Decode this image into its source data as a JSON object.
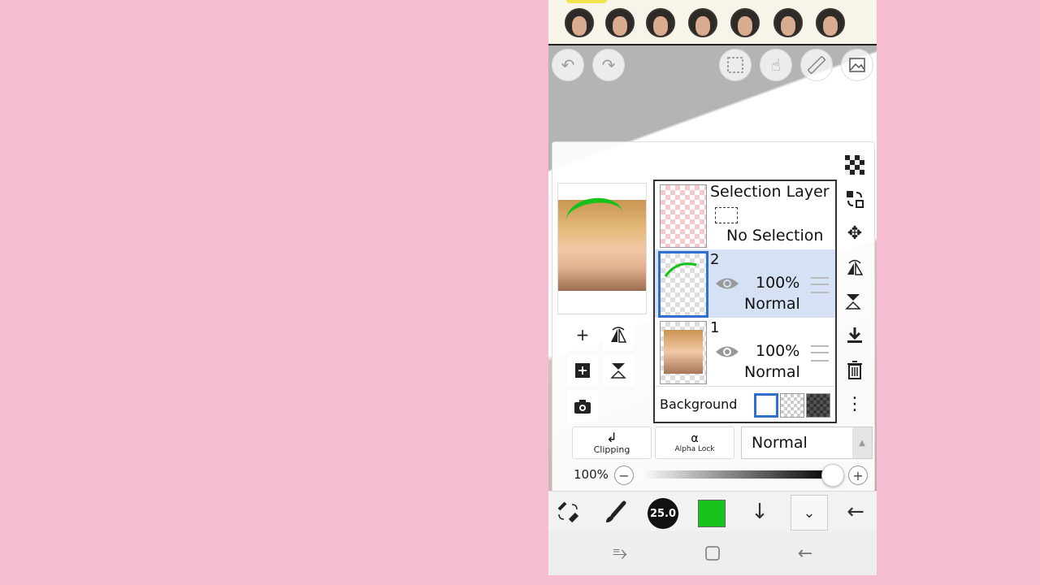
{
  "toolbar": {
    "undo_icon": "undo-icon",
    "redo_icon": "redo-icon",
    "selection_icon": "dashed-selection-icon",
    "hand_icon": "hand-pointer-icon",
    "ruler_icon": "ruler-icon",
    "image_icon": "image-icon"
  },
  "layers_panel": {
    "selection_layer": {
      "title": "Selection Layer",
      "status": "No Selection"
    },
    "layers": [
      {
        "number": "2",
        "opacity": "100%",
        "blend": "Normal",
        "selected": true
      },
      {
        "number": "1",
        "opacity": "100%",
        "blend": "Normal",
        "selected": false
      }
    ],
    "background_label": "Background",
    "clipping_label": "Clipping",
    "alpha_lock_label": "Alpha Lock",
    "alpha_symbol": "α",
    "blend_mode": "Normal",
    "opacity_value": "100%",
    "opacity_fraction": 1.0
  },
  "bottom_bar": {
    "brush_size": "25.0",
    "color": "#17c21b"
  },
  "colors": {
    "accent": "#2e6fd0",
    "selected_layer_bg": "#d6e1f5",
    "background_pink": "#f6bcd2"
  }
}
